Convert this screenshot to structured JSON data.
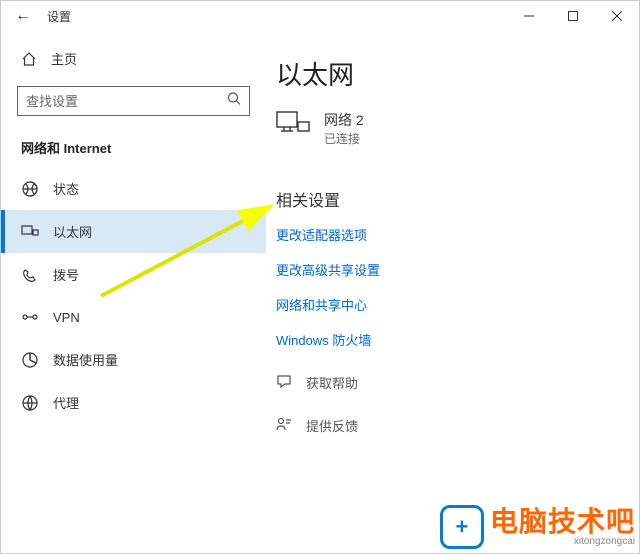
{
  "window": {
    "title": "设置"
  },
  "sidebar": {
    "home": "主页",
    "search_placeholder": "查找设置",
    "section": "网络和 Internet",
    "items": [
      {
        "label": "状态",
        "icon": "status"
      },
      {
        "label": "以太网",
        "icon": "ethernet"
      },
      {
        "label": "拨号",
        "icon": "dialup"
      },
      {
        "label": "VPN",
        "icon": "vpn"
      },
      {
        "label": "数据使用量",
        "icon": "data"
      },
      {
        "label": "代理",
        "icon": "proxy"
      }
    ]
  },
  "content": {
    "title": "以太网",
    "network": {
      "name": "网络 2",
      "status": "已连接"
    },
    "related_heading": "相关设置",
    "links": [
      "更改适配器选项",
      "更改高级共享设置",
      "网络和共享中心",
      "Windows 防火墙"
    ],
    "help": "获取帮助",
    "feedback": "提供反馈"
  },
  "watermark": {
    "logo_glyph": "+",
    "text": "电脑技术吧",
    "sub": "xitongzongcai"
  }
}
